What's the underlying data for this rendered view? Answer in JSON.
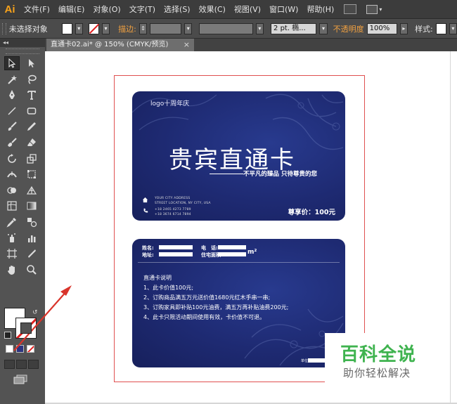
{
  "app": {
    "logo": "Ai"
  },
  "menu": [
    "文件(F)",
    "编辑(E)",
    "对象(O)",
    "文字(T)",
    "选择(S)",
    "效果(C)",
    "视图(V)",
    "窗口(W)",
    "帮助(H)"
  ],
  "control_bar": {
    "selection_status": "未选择对象",
    "stroke_label": "描边:",
    "stroke_profile": "2 pt. 椭...",
    "opacity_label": "不透明度",
    "opacity_value": "100%",
    "style_label": "样式:"
  },
  "document_tab": {
    "title": "直通卡02.ai* @ 150% (CMYK/预览)",
    "close": "×"
  },
  "toolbox": {
    "collapse": "◂◂"
  },
  "card_front": {
    "logo_text": "logo十周年庆",
    "title": "贵宾直通卡",
    "slogan": "不平凡的臻品 只待尊贵的您",
    "address_line1": "YOUR CITY ADDRESS",
    "address_line2": "STREET LOCATION, NY CITY, USA",
    "phone_line1": "+18 2465 4273 7789",
    "phone_line2": "+18 3674 6714 7894",
    "price": "尊享价：100元"
  },
  "card_back": {
    "name_label": "姓名:",
    "phone_label": "电　话:",
    "address_label": "地址:",
    "area_label": "住宅面积:",
    "area_unit": "m²",
    "heading": "直通卡说明",
    "lines": [
      "1、此卡价值100元;",
      "2、订购商品满五万元送价值1680元红木手串一串;",
      "3、订购家具即补贴100元油费，满五万再补贴油费200元;",
      "4、此卡只限活动期间使用有效，卡价值不可退。"
    ],
    "signature_label": "单位:"
  },
  "watermark": {
    "title": "百科全说",
    "subtitle": "助你轻松解决"
  },
  "colors": {
    "card_blue": "#1e2a72",
    "artboard_border": "#e05050",
    "arrow": "#d9342b",
    "watermark_green": "#3fb34f",
    "ai_orange": "#f7a21b"
  }
}
